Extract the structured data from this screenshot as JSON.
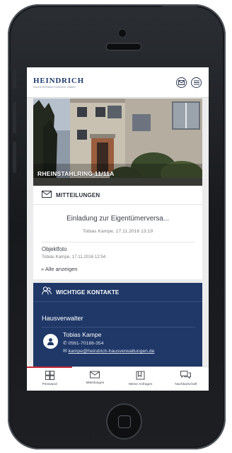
{
  "header": {
    "logo_name": "HEINDRICH",
    "logo_sub": "HAUSVERWALTUNGEN GMBH",
    "mail_icon": "mail-icon",
    "menu_icon": "menu-icon"
  },
  "hero": {
    "title": "RHEINSTAHLRING 11/11A"
  },
  "news": {
    "title": "MITTEILUNGEN",
    "featured_title": "Einladung zur Eigentümerversa...",
    "featured_meta": "Tobias Kampe, 17.11.2016 13:19",
    "item_title": "Objektfoto",
    "item_meta": "Tobias Kampe, 17.11.2016 12:54",
    "show_all": "» Alle anzeigen"
  },
  "contacts": {
    "title": "WICHTIGE KONTAKTE",
    "role": "Hausverwalter",
    "name": "Tobias Kampe",
    "phone": "0561-70188-354",
    "email": "kampe@heindrich-hausverwaltungen.de"
  },
  "tabs": [
    {
      "label": "Pinnwand",
      "icon": "grid-icon",
      "active": true
    },
    {
      "label": "Mitteilungen",
      "icon": "mail-icon",
      "active": false
    },
    {
      "label": "Meine Anfragen",
      "icon": "folder-icon",
      "active": false
    },
    {
      "label": "Nachbarschaft",
      "icon": "chat-icon",
      "active": false
    }
  ],
  "colors": {
    "brand_blue": "#1f3868",
    "active_tab": "#c92d3a"
  }
}
